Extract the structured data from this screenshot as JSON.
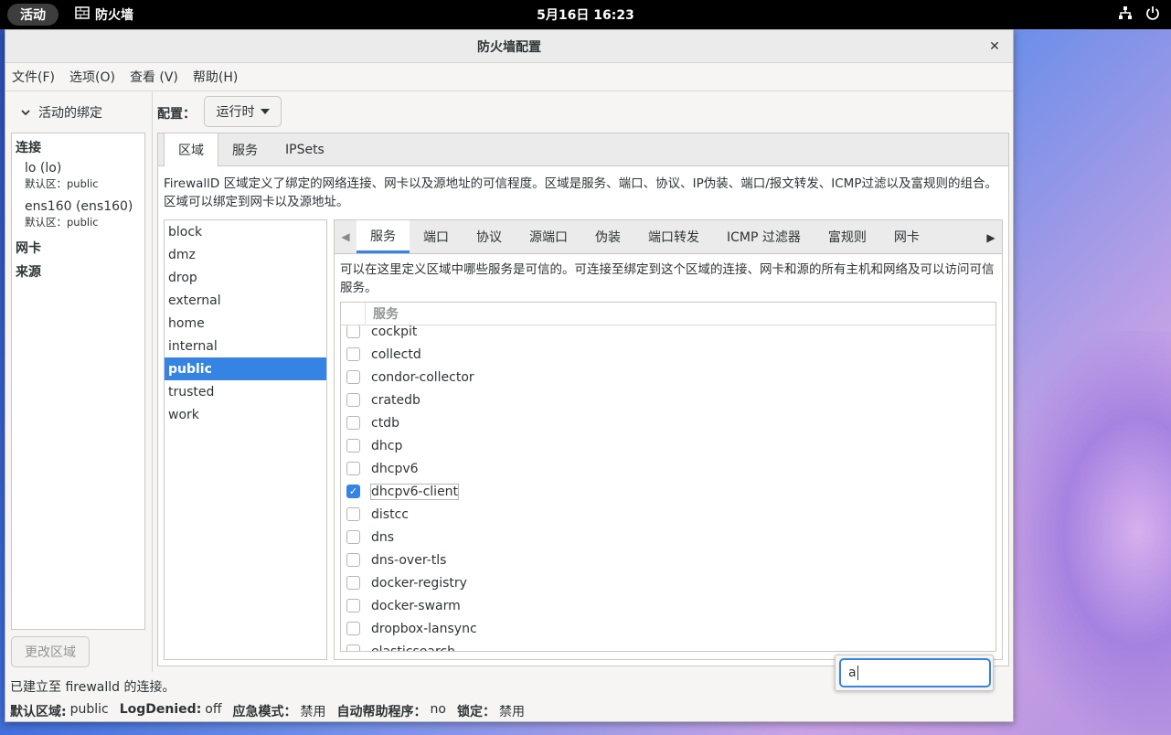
{
  "topbar": {
    "activities": "活动",
    "app_name": "防火墙",
    "clock": "5月16日 16:23"
  },
  "window": {
    "title": "防火墙配置",
    "menu": [
      "文件(F)",
      "选项(O)",
      "查看 (V)",
      "帮助(H)"
    ]
  },
  "bindings": {
    "expander_label": "活动的绑定",
    "connections_header": "连接",
    "connections": [
      {
        "name": "lo (lo)",
        "zone": "默认区：public"
      },
      {
        "name": "ens160 (ens160)",
        "zone": "默认区：public"
      }
    ],
    "interfaces_header": "网卡",
    "sources_header": "来源",
    "change_zone_button": "更改区域"
  },
  "config": {
    "label": "配置：",
    "value": "运行时"
  },
  "main_tabs": [
    "区域",
    "服务",
    "IPSets"
  ],
  "zone_description": "FirewallD 区域定义了绑定的网络连接、网卡以及源地址的可信程度。区域是服务、端口、协议、IP伪装、端口/报文转发、ICMP过滤以及富规则的组合。区域可以绑定到网卡以及源地址。",
  "zones": [
    "block",
    "dmz",
    "drop",
    "external",
    "home",
    "internal",
    "public",
    "trusted",
    "work"
  ],
  "selected_zone": "public",
  "zone_tabs": [
    "服务",
    "端口",
    "协议",
    "源端口",
    "伪装",
    "端口转发",
    "ICMP 过滤器",
    "富规则",
    "网卡"
  ],
  "services_description": "可以在这里定义区域中哪些服务是可信的。可连接至绑定到这个区域的连接、网卡和源的所有主机和网络及可以访问可信服务。",
  "services_header": "服务",
  "services": [
    {
      "name": "cockpit",
      "checked": false
    },
    {
      "name": "collectd",
      "checked": false
    },
    {
      "name": "condor-collector",
      "checked": false
    },
    {
      "name": "cratedb",
      "checked": false
    },
    {
      "name": "ctdb",
      "checked": false
    },
    {
      "name": "dhcp",
      "checked": false
    },
    {
      "name": "dhcpv6",
      "checked": false
    },
    {
      "name": "dhcpv6-client",
      "checked": true
    },
    {
      "name": "distcc",
      "checked": false
    },
    {
      "name": "dns",
      "checked": false
    },
    {
      "name": "dns-over-tls",
      "checked": false
    },
    {
      "name": "docker-registry",
      "checked": false
    },
    {
      "name": "docker-swarm",
      "checked": false
    },
    {
      "name": "dropbox-lansync",
      "checked": false
    },
    {
      "name": "elasticsearch",
      "checked": false
    }
  ],
  "status": {
    "connection": "已建立至 firewalld 的连接。",
    "default_zone_label": "默认区域:",
    "default_zone_value": "public",
    "log_denied_label": "LogDenied:",
    "log_denied_value": "off",
    "panic_label": "应急模式：",
    "panic_value": "禁用",
    "helper_label": "自动帮助程序：",
    "helper_value": "no",
    "lockdown_label": "锁定：",
    "lockdown_value": "禁用"
  },
  "search": {
    "value": "a"
  },
  "colors": {
    "accent": "#3584e4",
    "topbar": "#000000"
  }
}
